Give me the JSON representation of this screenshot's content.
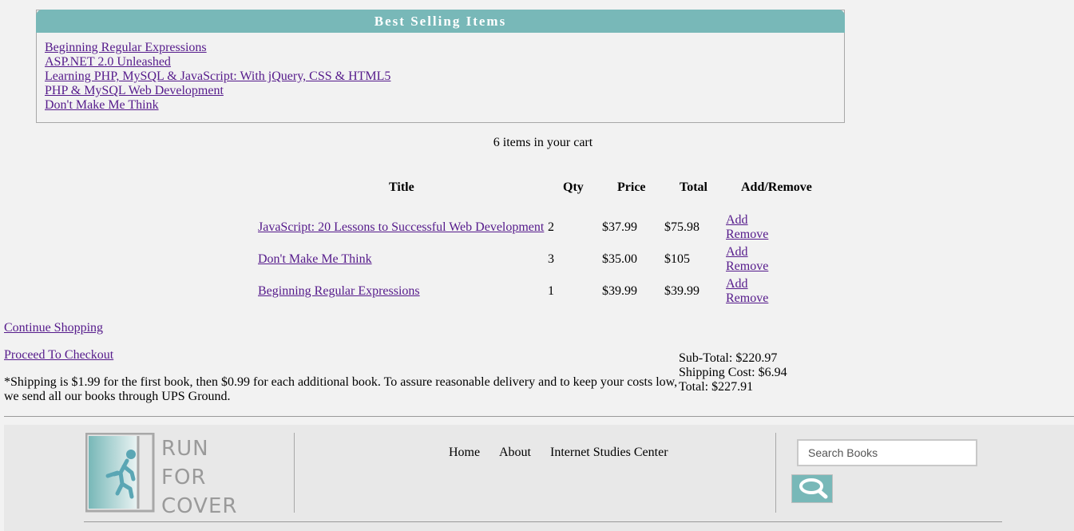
{
  "best_selling": {
    "title": "Best Selling Items",
    "items": [
      "Beginning Regular Expressions",
      "ASP.NET 2.0 Unleashed",
      "Learning PHP, MySQL & JavaScript: With jQuery, CSS & HTML5",
      "PHP & MySQL Web Development",
      "Don't Make Me Think"
    ]
  },
  "cart": {
    "count_text": "6 items in your cart",
    "headers": {
      "title": "Title",
      "qty": "Qty",
      "price": "Price",
      "total": "Total",
      "add_remove": "Add/Remove"
    },
    "rows": [
      {
        "title": "JavaScript: 20 Lessons to Successful Web Development",
        "qty": "2",
        "price": "$37.99",
        "total": "$75.98",
        "add": "Add",
        "remove": "Remove"
      },
      {
        "title": "Don't Make Me Think",
        "qty": "3",
        "price": "$35.00",
        "total": "$105",
        "add": "Add",
        "remove": "Remove"
      },
      {
        "title": "Beginning Regular Expressions",
        "qty": "1",
        "price": "$39.99",
        "total": "$39.99",
        "add": "Add",
        "remove": "Remove"
      }
    ]
  },
  "links": {
    "continue": "Continue Shopping",
    "checkout": "Proceed To Checkout"
  },
  "shipping_note": "*Shipping is $1.99 for the first book, then $0.99 for each additional book. To assure reasonable delivery and to keep your costs low, we send all our books through UPS Ground.",
  "totals": {
    "subtotal": "Sub-Total: $220.97",
    "shipping": "Shipping Cost: $6.94",
    "total": "Total: $227.91"
  },
  "footer": {
    "logo_lines": [
      "RUN",
      "FOR",
      "COVER"
    ],
    "nav": [
      "Home",
      "About",
      "Internet Studies Center"
    ],
    "search_placeholder": "Search Books",
    "search_icon": "magnifier-icon"
  },
  "colors": {
    "accent": "#78b8b8",
    "link": "#551a8b"
  }
}
